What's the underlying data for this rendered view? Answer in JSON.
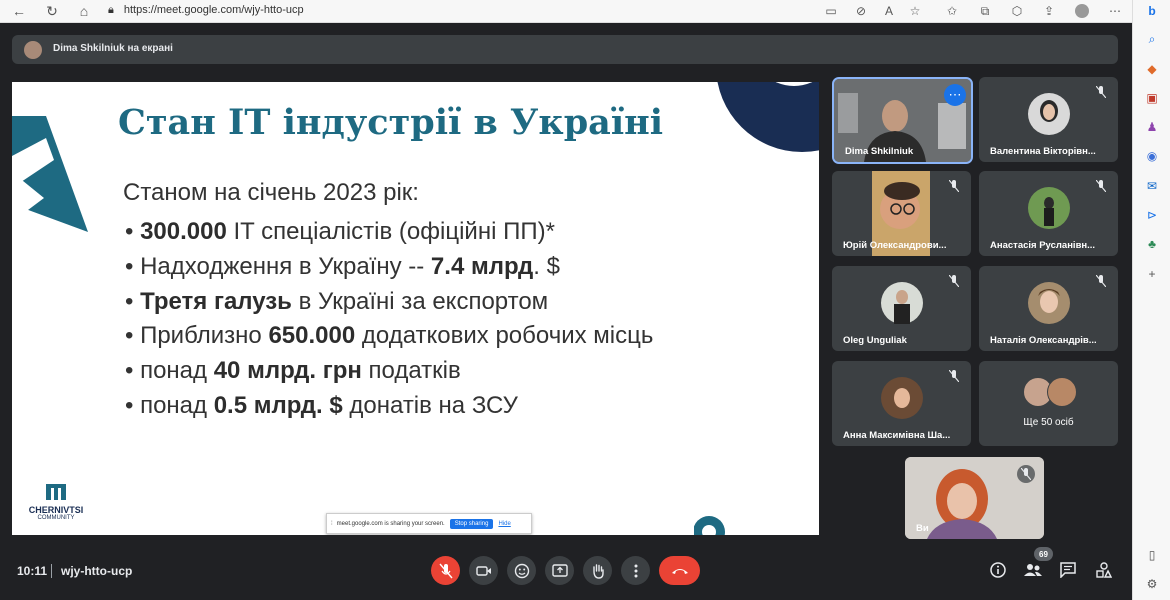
{
  "browser": {
    "url": "https://meet.google.com/wjy-htto-ucp"
  },
  "banner": {
    "text": "Dima Shkilniuk на екрані"
  },
  "slide": {
    "title": "Стан IT індустрії в Україні",
    "intro": "Станом на січень 2023 рік:",
    "bullets": [
      {
        "bold": "300.000",
        "rest": " IT спеціалістів (офіційні ПП)*"
      },
      {
        "pre": "Надходження в Україну --  ",
        "bold": "7.4 млрд",
        "rest": ". $"
      },
      {
        "bold": "Третя галузь",
        "rest": " в Україні за експортом"
      },
      {
        "pre": "Приблизно ",
        "bold": "650.000",
        "rest": " додаткових робочих місць"
      },
      {
        "pre": "понад ",
        "bold": "40 млрд. грн",
        "rest": " податків"
      },
      {
        "pre": "понад ",
        "bold": "0.5 млрд. $",
        "rest": "  донатів на ЗСУ"
      }
    ],
    "logo_name": "CHERNIVTSI",
    "logo_sub": "COMMUNITY",
    "share_text": "meet.google.com is sharing your screen.",
    "stop_sharing": "Stop sharing",
    "hide": "Hide"
  },
  "participants": [
    {
      "name": "Dima Shkilniuk"
    },
    {
      "name": "Валентина Вікторівн..."
    },
    {
      "name": "Юрій Олександрови..."
    },
    {
      "name": "Анастасія Русланівн..."
    },
    {
      "name": "Oleg Unguliak"
    },
    {
      "name": "Наталія Олександрів..."
    },
    {
      "name": "Анна Максимівна Ша..."
    },
    {
      "name": "Ще 50 осіб"
    }
  ],
  "self_tile": {
    "name": "Ви"
  },
  "bottom": {
    "time": "10:11",
    "meeting_code": "wjy-htto-ucp",
    "participants_count": "69"
  },
  "colors": {
    "background": "#202124",
    "slide_title": "#1e6a82",
    "leave_red": "#ea4335",
    "active_blue": "#8ab4f8"
  }
}
